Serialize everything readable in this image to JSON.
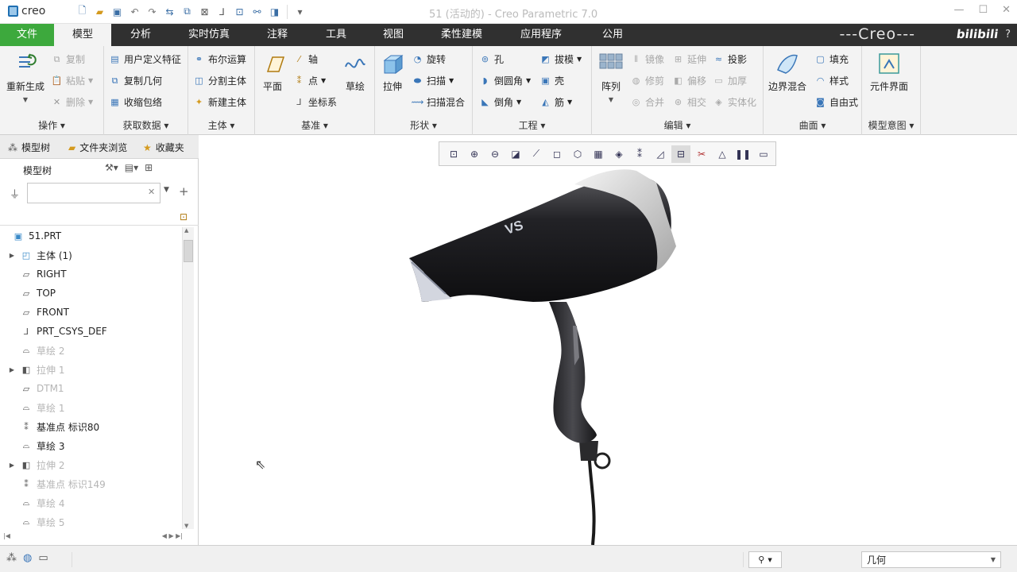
{
  "app": {
    "logo": "creo",
    "window_title": "51 (活动的) - Creo Parametric 7.0"
  },
  "tabs": [
    {
      "label": "文件"
    },
    {
      "label": "模型"
    },
    {
      "label": "分析"
    },
    {
      "label": "实时仿真"
    },
    {
      "label": "注释"
    },
    {
      "label": "工具"
    },
    {
      "label": "视图"
    },
    {
      "label": "柔性建模"
    },
    {
      "label": "应用程序"
    },
    {
      "label": "公用"
    }
  ],
  "brand": "---Creo---",
  "watermark": "bilibili",
  "ribbon": {
    "ops": {
      "regen": "重新生成",
      "copy": "复制",
      "paste": "粘贴",
      "delete": "删除",
      "label": "操作"
    },
    "getdata": {
      "udf": "用户定义特征",
      "copygeom": "复制几何",
      "shrink": "收缩包络",
      "label": "获取数据"
    },
    "body": {
      "bool": "布尔运算",
      "split": "分割主体",
      "newbody": "新建主体",
      "label": "主体"
    },
    "datum": {
      "plane": "平面",
      "axis": "轴",
      "point": "点",
      "csys": "坐标系",
      "sketch": "草绘",
      "label": "基准"
    },
    "shapes": {
      "extrude": "拉伸",
      "revolve": "旋转",
      "sweep": "扫描",
      "sweepblend": "扫描混合",
      "label": "形状"
    },
    "eng": {
      "hole": "孔",
      "round": "倒圆角",
      "chamfer": "倒角",
      "draft": "拔模",
      "shell": "壳",
      "rib": "筋",
      "label": "工程"
    },
    "edit": {
      "pattern": "阵列",
      "mirror": "镜像",
      "extend": "延伸",
      "project": "投影",
      "trim": "修剪",
      "offset": "偏移",
      "thicken": "加厚",
      "merge": "合并",
      "intersect": "相交",
      "solidify": "实体化",
      "label": "编辑"
    },
    "surfaces": {
      "boundary": "边界混合",
      "fill": "填充",
      "style": "样式",
      "freestyle": "自由式",
      "label": "曲面"
    },
    "intent": {
      "component": "元件界面",
      "label": "模型意图"
    }
  },
  "panel": {
    "tabs": [
      "模型树",
      "文件夹浏览",
      "收藏夹"
    ],
    "header": "模型树",
    "search_placeholder": "",
    "tree": [
      {
        "label": "51.PRT",
        "icon": "part-icon",
        "dim": false,
        "arrow": false
      },
      {
        "label": "主体 (1)",
        "icon": "body-icon",
        "dim": false,
        "arrow": true
      },
      {
        "label": "RIGHT",
        "icon": "plane-icon",
        "dim": false,
        "arrow": false
      },
      {
        "label": "TOP",
        "icon": "plane-icon",
        "dim": false,
        "arrow": false
      },
      {
        "label": "FRONT",
        "icon": "plane-icon",
        "dim": false,
        "arrow": false
      },
      {
        "label": "PRT_CSYS_DEF",
        "icon": "csys-icon",
        "dim": false,
        "arrow": false
      },
      {
        "label": "草绘 2",
        "icon": "sketch-icon",
        "dim": true,
        "arrow": false
      },
      {
        "label": "拉伸 1",
        "icon": "extrude-icon",
        "dim": true,
        "arrow": true
      },
      {
        "label": "DTM1",
        "icon": "plane-icon",
        "dim": true,
        "arrow": false
      },
      {
        "label": "草绘 1",
        "icon": "sketch-icon",
        "dim": true,
        "arrow": false
      },
      {
        "label": "基准点 标识80",
        "icon": "point-icon",
        "dim": false,
        "arrow": false
      },
      {
        "label": "草绘 3",
        "icon": "sketch-icon",
        "dim": false,
        "arrow": false
      },
      {
        "label": "拉伸 2",
        "icon": "extrude-icon",
        "dim": true,
        "arrow": true
      },
      {
        "label": "基准点 标识149",
        "icon": "point-icon",
        "dim": true,
        "arrow": false
      },
      {
        "label": "草绘 4",
        "icon": "sketch-icon",
        "dim": true,
        "arrow": false
      },
      {
        "label": "草绘 5",
        "icon": "sketch-icon",
        "dim": true,
        "arrow": false
      }
    ]
  },
  "status": {
    "filter_value": "几何"
  }
}
